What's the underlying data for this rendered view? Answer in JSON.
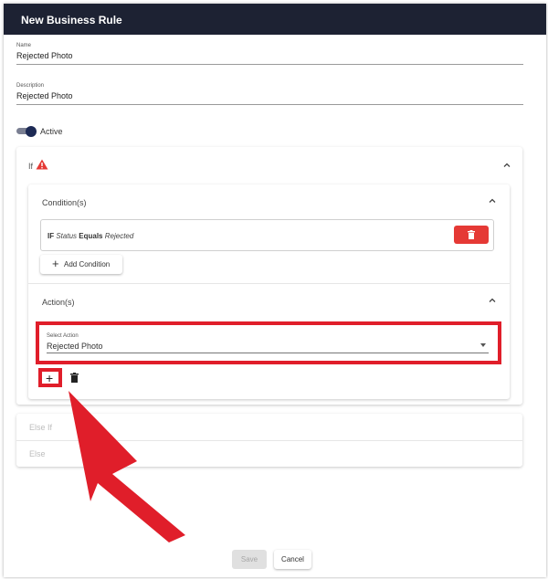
{
  "dialog": {
    "title": "New Business Rule"
  },
  "name_field": {
    "label": "Name",
    "value": "Rejected Photo"
  },
  "description_field": {
    "label": "Description",
    "value": "Rejected Photo"
  },
  "active_toggle": {
    "label": "Active",
    "on": true
  },
  "if_section": {
    "label": "If",
    "conditions": {
      "title": "Condition(s)",
      "rows": [
        {
          "prefix": "IF",
          "field": "Status",
          "operator": "Equals",
          "value": "Rejected"
        }
      ],
      "add_label": "Add Condition"
    },
    "actions": {
      "title": "Action(s)",
      "select_label": "Select Action",
      "select_value": "Rejected Photo"
    }
  },
  "else_if": {
    "label": "Else If"
  },
  "else": {
    "label": "Else"
  },
  "footer": {
    "save_label": "Save",
    "cancel_label": "Cancel"
  },
  "colors": {
    "titlebar": "#1d2233",
    "delete_button": "#e53935",
    "annotation_red": "#e01e2a",
    "toggle_knob": "#1d2a55"
  }
}
